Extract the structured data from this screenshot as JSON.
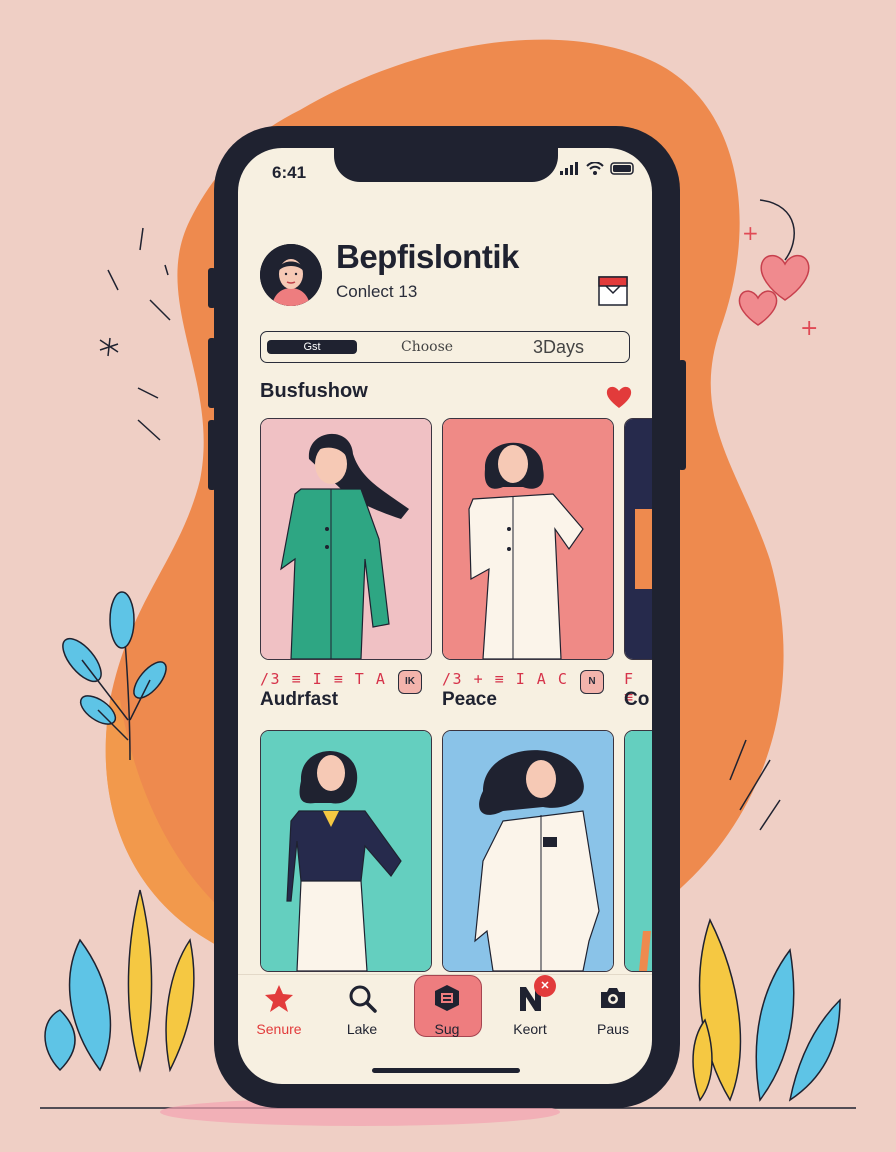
{
  "status_bar": {
    "time": "6:41"
  },
  "profile": {
    "name": "Bepfislontik",
    "subtitle": "Conlect 13"
  },
  "segmented_control": {
    "options": [
      "Gst",
      "Choose",
      "3Days"
    ],
    "selected_index": 0
  },
  "section": {
    "title": "Busfushow"
  },
  "cards": [
    {
      "code": "/3 ≡ I ≡ T A",
      "name": "Audrfast",
      "badge": "IK",
      "bg": "#f0c1c4"
    },
    {
      "code": "/3 + ≡ I A C",
      "name": "Peace",
      "badge": "N",
      "bg": "#ef8a86"
    },
    {
      "code": "F ≡",
      "name": "Co",
      "badge": "",
      "bg": "#262a4c"
    },
    {
      "code": "",
      "name": "",
      "badge": "",
      "bg": "#64cfbf"
    },
    {
      "code": "",
      "name": "",
      "badge": "",
      "bg": "#8ac3e8"
    },
    {
      "code": "",
      "name": "",
      "badge": "",
      "bg": "#64cfbf"
    }
  ],
  "tab_bar": {
    "tabs": [
      {
        "label": "Senure",
        "icon": "star-icon",
        "active": false
      },
      {
        "label": "Lake",
        "icon": "search-icon",
        "active": false
      },
      {
        "label": "Sug",
        "icon": "hexagon-icon",
        "active": true
      },
      {
        "label": "Keort",
        "icon": "n-logo-icon",
        "active": false
      },
      {
        "label": "Paus",
        "icon": "camera-icon",
        "active": false
      }
    ],
    "notification_badge": "✕"
  },
  "colors": {
    "background": "#efcfc5",
    "blob": "#ee8a4e",
    "phone_frame": "#1f2230",
    "screen": "#f7f0e1",
    "accent_red": "#e23b3b"
  }
}
